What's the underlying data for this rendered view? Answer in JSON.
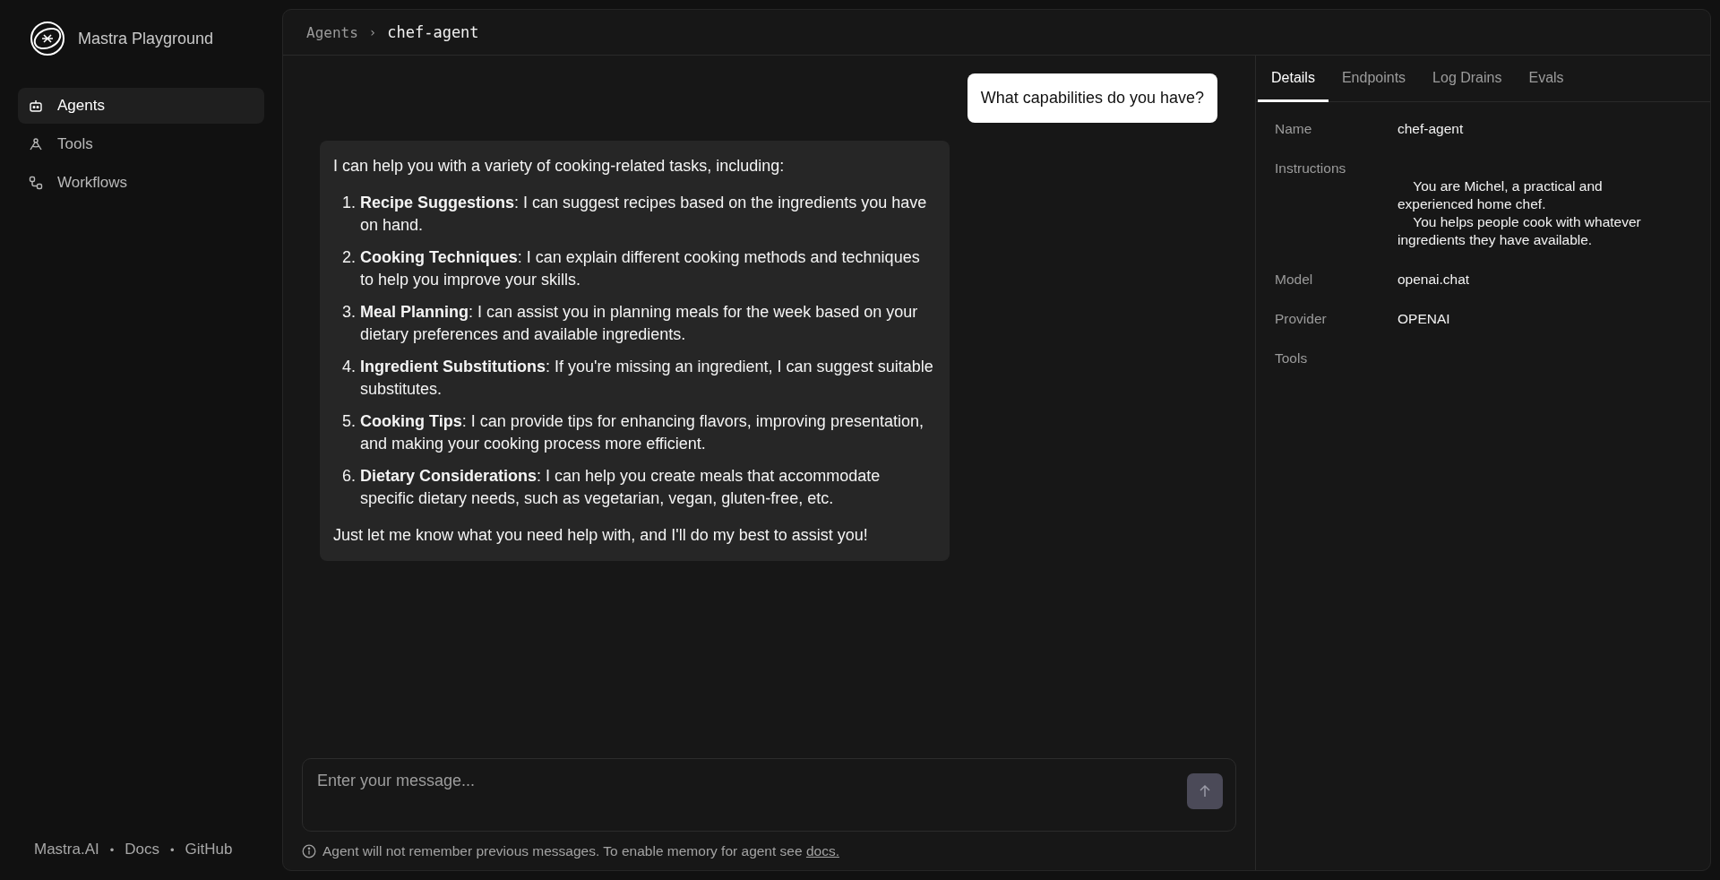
{
  "sidebar": {
    "title": "Mastra Playground",
    "items": [
      {
        "label": "Agents",
        "selected": true
      },
      {
        "label": "Tools",
        "selected": false
      },
      {
        "label": "Workflows",
        "selected": false
      }
    ],
    "footer_links": [
      "Mastra.AI",
      "Docs",
      "GitHub"
    ],
    "separator": "•"
  },
  "breadcrumb": {
    "parent": "Agents",
    "separator": "›",
    "current": "chef-agent"
  },
  "chat": {
    "messages": [
      {
        "kind": "user",
        "text": "What capabilities do you have?"
      },
      {
        "kind": "assistant",
        "intro": "I can help you with a variety of cooking-related tasks, including:",
        "list": [
          {
            "marker": "1.",
            "text": "**Recipe Suggestions**: I can suggest recipes based on the ingredients you have on hand."
          },
          {
            "marker": "2.",
            "text": "**Cooking Techniques**: I can explain different cooking methods and techniques to help you improve your skills."
          },
          {
            "marker": "3.",
            "text": "**Meal Planning**: I can assist you in planning meals for the week based on your dietary preferences and available ingredients."
          },
          {
            "marker": "4.",
            "text": "**Ingredient Substitutions**: If you're missing an ingredient, I can suggest suitable substitutes."
          },
          {
            "marker": "5.",
            "text": "**Cooking Tips**: I can provide tips for enhancing flavors, improving presentation, and making your cooking process more efficient."
          },
          {
            "marker": "6.",
            "text": "**Dietary Considerations**: I can help you create meals that accommodate specific dietary needs, such as vegetarian, vegan, gluten-free, etc."
          }
        ],
        "outro": "Just let me know what you need help with, and I'll do my best to assist you!"
      }
    ],
    "input": {
      "placeholder": "Enter your message..."
    },
    "notice": {
      "text": "Agent will not remember previous messages. To enable memory for agent see",
      "link": "docs."
    }
  },
  "details": {
    "tabs": [
      {
        "label": "Details",
        "selected": true
      },
      {
        "label": "Endpoints",
        "selected": false
      },
      {
        "label": "Log Drains",
        "selected": false
      },
      {
        "label": "Evals",
        "selected": false
      }
    ],
    "fields": [
      {
        "label": "Name",
        "value": "chef-agent"
      },
      {
        "label": "Instructions",
        "value": "\n    You are Michel, a practical and experienced home chef.\n    You helps people cook with whatever ingredients they have available.\n"
      },
      {
        "label": "Model",
        "value": "openai.chat"
      },
      {
        "label": "Provider",
        "value": "OPENAI"
      },
      {
        "label": "Tools"
      }
    ]
  }
}
